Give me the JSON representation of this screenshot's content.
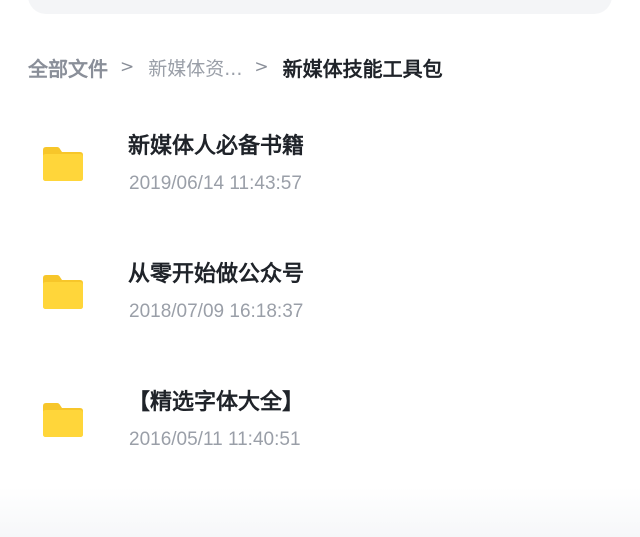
{
  "breadcrumb": {
    "root": "全部文件",
    "separator": ">",
    "middle": "新媒体资...",
    "current": "新媒体技能工具包"
  },
  "files": [
    {
      "name": "新媒体人必备书籍",
      "modified": "2019/06/14 11:43:57",
      "icon": "folder-icon"
    },
    {
      "name": "从零开始做公众号",
      "modified": "2018/07/09 16:18:37",
      "icon": "folder-icon"
    },
    {
      "name": "【精选字体大全】",
      "modified": "2016/05/11 11:40:51",
      "icon": "folder-icon"
    }
  ],
  "colors": {
    "folder": "#ffd63a",
    "folder_tab": "#f7c62a",
    "text_primary": "#1f2329",
    "text_secondary": "#9a9fa8"
  }
}
